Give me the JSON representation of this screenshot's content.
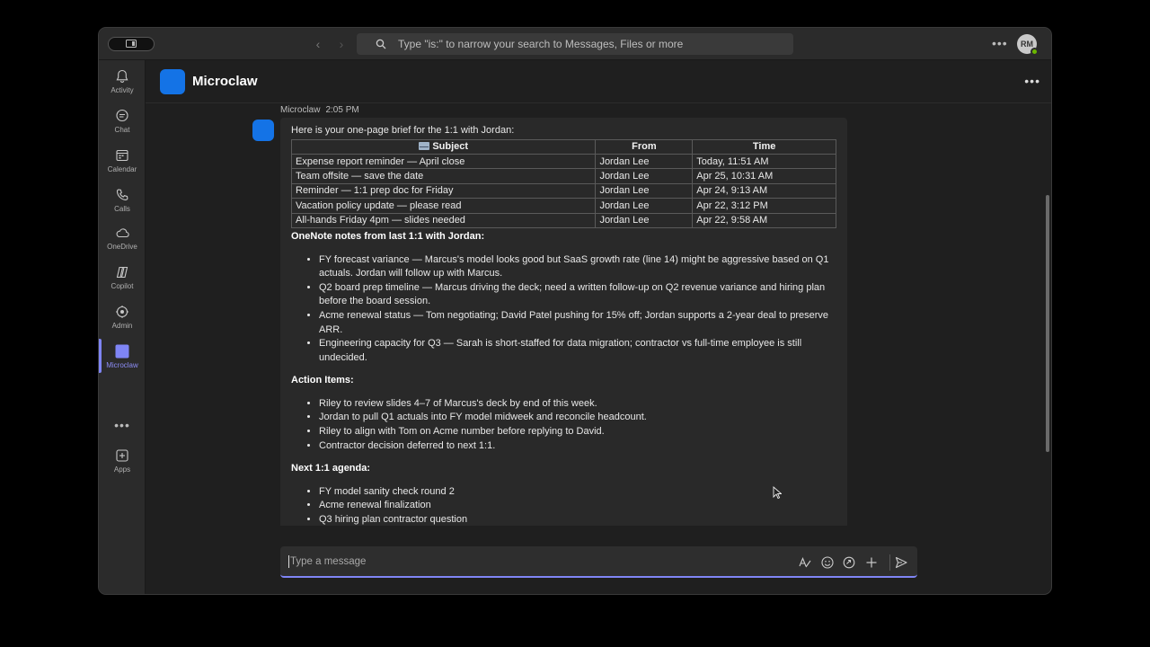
{
  "search": {
    "placeholder": "Type \"is:\" to narrow your search to Messages, Files or more"
  },
  "user": {
    "initials": "RM"
  },
  "rail": [
    {
      "label": "Activity",
      "icon": "bell-icon"
    },
    {
      "label": "Chat",
      "icon": "chat-icon"
    },
    {
      "label": "Calendar",
      "icon": "calendar-icon"
    },
    {
      "label": "Calls",
      "icon": "phone-icon"
    },
    {
      "label": "OneDrive",
      "icon": "cloud-icon"
    },
    {
      "label": "Copilot",
      "icon": "copilot-icon"
    },
    {
      "label": "Admin",
      "icon": "admin-icon"
    },
    {
      "label": "Microclaw",
      "icon": "microclaw-app-icon"
    },
    {
      "label": "Apps",
      "icon": "add-apps-icon"
    }
  ],
  "chat": {
    "title": "Microclaw"
  },
  "message": {
    "sender": "Microclaw",
    "time": "2:05 PM",
    "intro": "Here is your one-page brief for the 1:1 with Jordan:",
    "table": {
      "headers": {
        "subject": "Subject",
        "from": "From",
        "time": "Time"
      },
      "rows": [
        {
          "subject": "Expense report reminder — April close",
          "from": "Jordan Lee",
          "time": "Today, 11:51 AM"
        },
        {
          "subject": "Team offsite — save the date",
          "from": "Jordan Lee",
          "time": "Apr 25, 10:31 AM"
        },
        {
          "subject": "Reminder — 1:1 prep doc for Friday",
          "from": "Jordan Lee",
          "time": "Apr 24, 9:13 AM"
        },
        {
          "subject": "Vacation policy update — please read",
          "from": "Jordan Lee",
          "time": "Apr 22, 3:12 PM"
        },
        {
          "subject": "All-hands Friday 4pm — slides needed",
          "from": "Jordan Lee",
          "time": "Apr 22, 9:58 AM"
        }
      ]
    },
    "notes_heading": "OneNote notes from last 1:1 with Jordan:",
    "notes": [
      "FY forecast variance — Marcus's model looks good but SaaS growth rate (line 14) might be aggressive based on Q1 actuals. Jordan will follow up with Marcus.",
      "Q2 board prep timeline — Marcus driving the deck; need a written follow-up on Q2 revenue variance and hiring plan before the board session.",
      "Acme renewal status — Tom negotiating; David Patel pushing for 15% off; Jordan supports a 2-year deal to preserve ARR.",
      "Engineering capacity for Q3 — Sarah is short-staffed for data migration; contractor vs full-time employee is still undecided."
    ],
    "actions_heading": "Action Items:",
    "actions": [
      "Riley to review slides 4–7 of Marcus's deck by end of this week.",
      "Jordan to pull Q1 actuals into FY model midweek and reconcile headcount.",
      "Riley to align with Tom on Acme number before replying to David.",
      "Contractor decision deferred to next 1:1."
    ],
    "agenda_heading": "Next 1:1 agenda:",
    "agenda": [
      "FY model sanity check round 2",
      "Acme renewal finalization",
      "Q3 hiring plan contractor question"
    ]
  },
  "composer": {
    "placeholder": "Type a message"
  },
  "colors": {
    "accent": "#7f85f5",
    "bot_icon": "#1473e6",
    "presence": "#6bb700"
  }
}
